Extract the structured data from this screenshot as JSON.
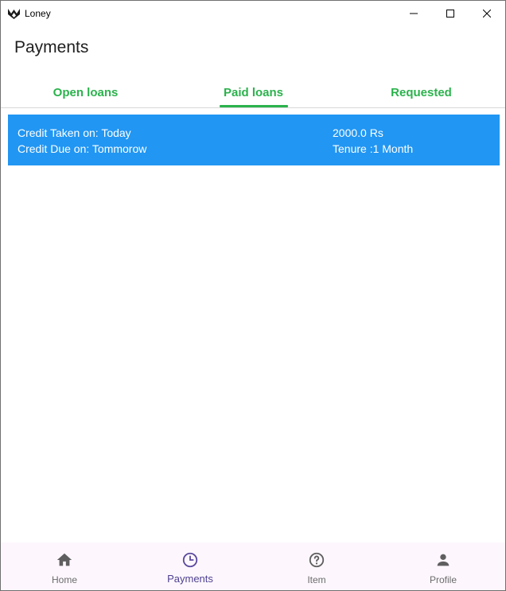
{
  "window": {
    "title": "Loney",
    "icon": "loney-logo-icon"
  },
  "page": {
    "title": "Payments"
  },
  "tabs": [
    {
      "label": "Open loans",
      "selected": false
    },
    {
      "label": "Paid loans",
      "selected": true
    },
    {
      "label": "Requested",
      "selected": false
    }
  ],
  "loans": [
    {
      "taken": "Credit Taken on: Today",
      "due": "Credit Due on: Tommorow",
      "amount": "2000.0 Rs",
      "tenure": "Tenure :1 Month"
    }
  ],
  "bottom_nav": [
    {
      "label": "Home",
      "icon": "home-icon",
      "active": false
    },
    {
      "label": "Payments",
      "icon": "clock-icon",
      "active": true
    },
    {
      "label": "Item",
      "icon": "help-circle-icon",
      "active": false
    },
    {
      "label": "Profile",
      "icon": "person-icon",
      "active": false
    }
  ],
  "colors": {
    "accent_green": "#2bb24c",
    "card_blue": "#2196f3",
    "nav_active": "#4e3f91",
    "nav_inactive": "#6b6b6b",
    "nav_background": "#fdf7fd"
  }
}
